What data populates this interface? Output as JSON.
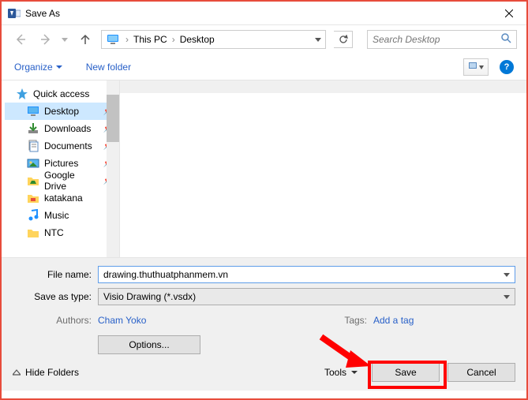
{
  "window": {
    "title": "Save As"
  },
  "nav": {
    "path": {
      "root": "This PC",
      "current": "Desktop"
    },
    "search_placeholder": "Search Desktop"
  },
  "toolbar": {
    "organize": "Organize",
    "newfolder": "New folder",
    "help": "?"
  },
  "tree": {
    "quick_access": "Quick access",
    "items": [
      {
        "label": "Desktop",
        "icon": "desktop",
        "pinned": true,
        "selected": true
      },
      {
        "label": "Downloads",
        "icon": "downloads",
        "pinned": true
      },
      {
        "label": "Documents",
        "icon": "documents",
        "pinned": true
      },
      {
        "label": "Pictures",
        "icon": "pictures",
        "pinned": true
      },
      {
        "label": "Google Drive",
        "icon": "folder-gd",
        "pinned": true
      },
      {
        "label": "katakana",
        "icon": "folder-k"
      },
      {
        "label": "Music",
        "icon": "music"
      },
      {
        "label": "NTC",
        "icon": "folder"
      }
    ]
  },
  "form": {
    "filename_label": "File name:",
    "filename_value": "drawing.thuthuatphanmem.vn",
    "type_label": "Save as type:",
    "type_value": "Visio Drawing (*.vsdx)",
    "authors_label": "Authors:",
    "authors_value": "Cham Yoko",
    "tags_label": "Tags:",
    "tags_value": "Add a tag",
    "options": "Options..."
  },
  "bottom": {
    "hide_folders": "Hide Folders",
    "tools": "Tools",
    "save": "Save",
    "cancel": "Cancel"
  }
}
